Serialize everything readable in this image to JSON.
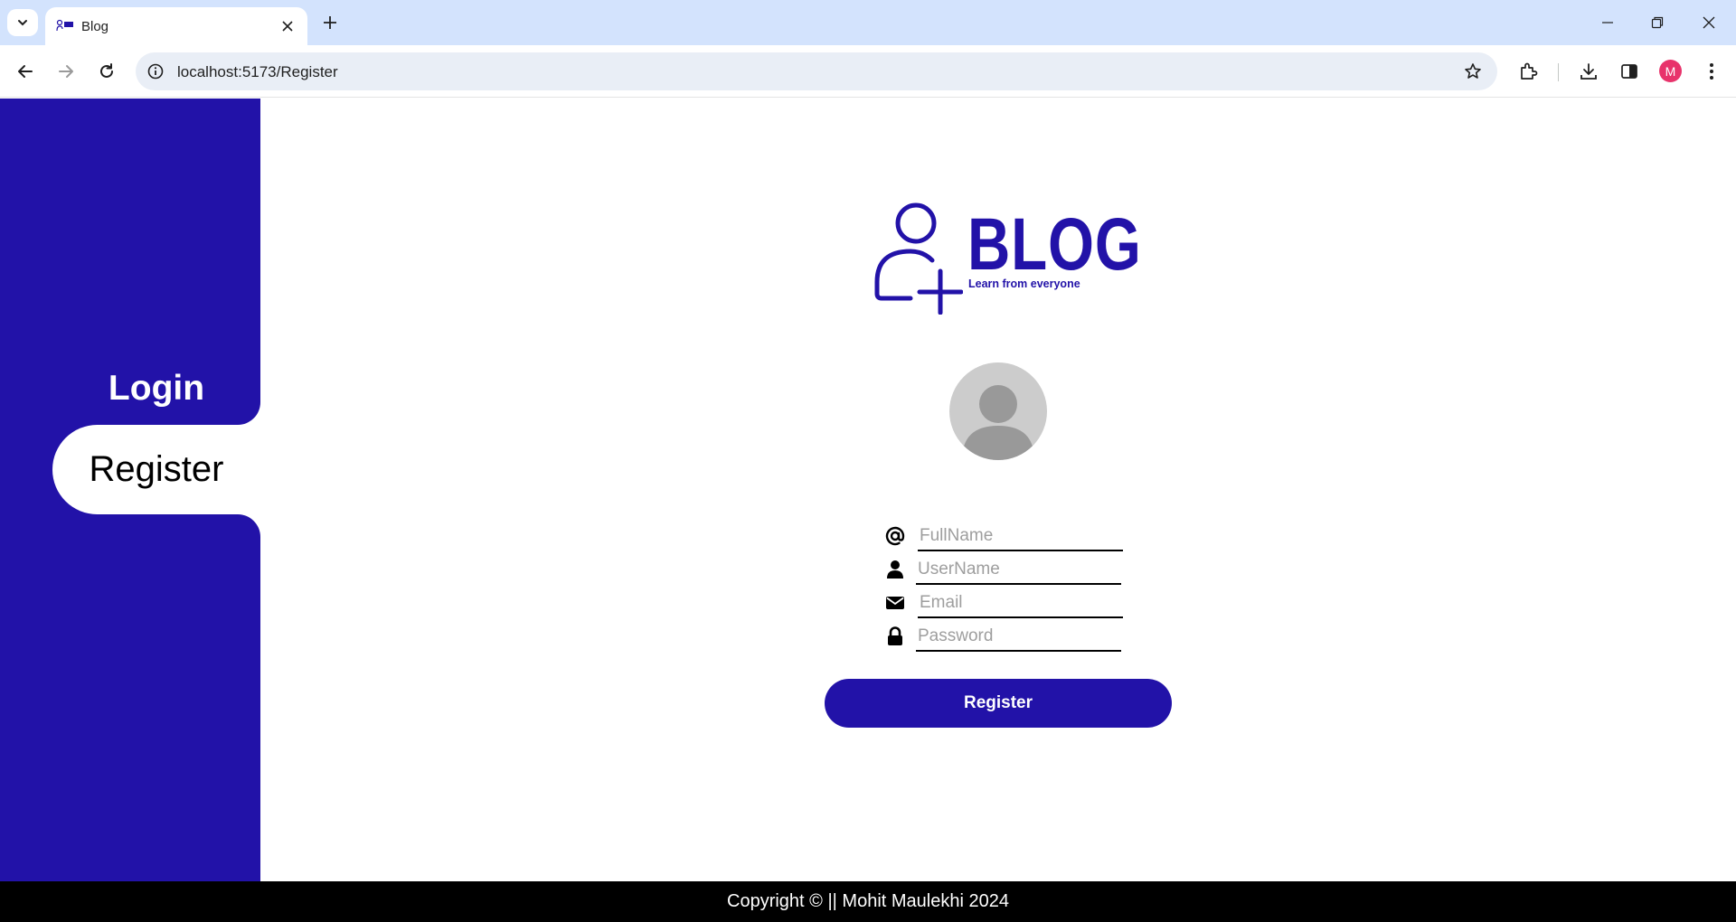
{
  "browser": {
    "tab_title": "Blog",
    "url": "localhost:5173/Register",
    "profile_initial": "M"
  },
  "sidebar": {
    "login_label": "Login",
    "register_label": "Register"
  },
  "logo": {
    "title": "BLOG",
    "tagline": "Learn from everyone"
  },
  "form": {
    "fullname_placeholder": "FullName",
    "username_placeholder": "UserName",
    "email_placeholder": "Email",
    "password_placeholder": "Password",
    "submit_label": "Register"
  },
  "footer": {
    "copyright": "Copyright © || Mohit Maulekhi 2024"
  },
  "colors": {
    "brand": "#2212a8",
    "footer_bg": "#000000",
    "tabstrip_bg": "#d3e3fd"
  },
  "icons": [
    "tab-search-icon",
    "blog-favicon-icon",
    "close-icon",
    "plus-icon",
    "minimize-icon",
    "restore-icon",
    "window-close-icon",
    "back-icon",
    "forward-icon",
    "reload-icon",
    "site-info-icon",
    "star-icon",
    "extensions-icon",
    "download-icon",
    "side-panel-icon",
    "more-icon",
    "at-icon",
    "user-icon",
    "envelope-icon",
    "lock-icon",
    "add-user-icon"
  ]
}
